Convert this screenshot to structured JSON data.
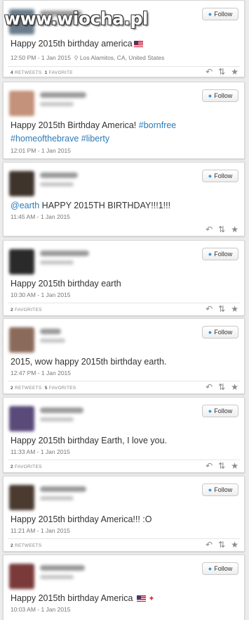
{
  "watermark": "www.wiocha.pl",
  "follow_label": "Follow",
  "colors": {
    "link": "#2b7bb9",
    "follow_bird": "#3b94d9",
    "background": "#ececec"
  },
  "tweets": [
    {
      "text": "Happy 2015th birthday america",
      "emoji": "us-flag",
      "time": "12:50 PM - 1 Jan 2015",
      "location": "Los Alamitos, CA, United States",
      "retweets_count": "4",
      "retweets_label": "RETWEETS",
      "favorites_count": "1",
      "favorites_label": "FAVORITE"
    },
    {
      "text_parts": [
        "Happy 2015th Birthday America! ",
        "#bornfree",
        "#homeofthebrave",
        " ",
        "#liberty"
      ],
      "time": "12:01 PM - 1 Jan 2015"
    },
    {
      "mention": "@earth",
      "text": " HAPPY 2015TH BIRTHDAY!!!1!!!",
      "time": "11:45 AM - 1 Jan 2015"
    },
    {
      "text": "Happy 2015th birthday earth",
      "time": "10:30 AM - 1 Jan 2015",
      "favorites_count": "2",
      "favorites_label": "FAVORITES"
    },
    {
      "text": "2015, wow happy 2015th birthday earth.",
      "time": "12:47 PM - 1 Jan 2015",
      "retweets_count": "2",
      "retweets_label": "RETWEETS",
      "favorites_count": "5",
      "favorites_label": "FAVORITES"
    },
    {
      "text": "Happy 2015th birthday Earth, I love you.",
      "time": "11:33 AM - 1 Jan 2015",
      "favorites_count": "2",
      "favorites_label": "FAVORITES"
    },
    {
      "text": "Happy 2015th birthday America!!! :O",
      "time": "11:21 AM - 1 Jan 2015",
      "retweets_count": "2",
      "retweets_label": "RETWEETS"
    },
    {
      "text": "Happy 2015th birthday America",
      "emoji": "us-flag party-popper",
      "time": "10:03 AM - 1 Jan 2015"
    }
  ],
  "icons": {
    "reply": "reply-icon",
    "retweet": "retweet-icon",
    "favorite": "favorite-star-icon",
    "location": "location-pin-icon"
  }
}
